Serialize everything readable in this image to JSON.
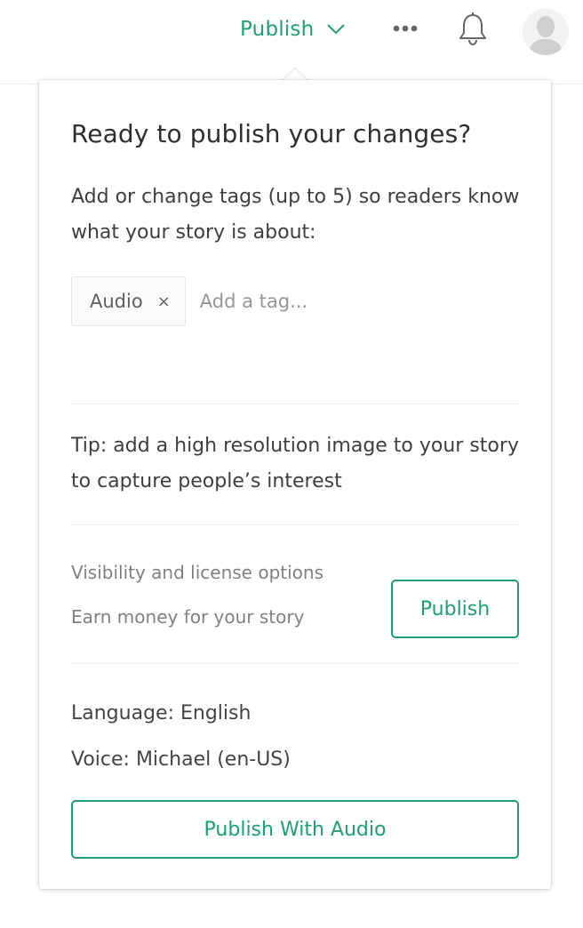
{
  "header": {
    "publish_menu_label": "Publish",
    "accent_color": "#1f9d74"
  },
  "icons": {
    "chevron": "chevron-down-icon",
    "more": "more-horizontal-icon",
    "bell": "bell-icon",
    "avatar": "user-avatar-icon"
  },
  "popover": {
    "title": "Ready to publish your changes?",
    "description": "Add or change tags (up to 5) so readers know what your story is about:",
    "tags": [
      {
        "label": "Audio",
        "remove_symbol": "×"
      }
    ],
    "tag_input_placeholder": "Add a tag...",
    "tip": "Tip: add a high resolution image to your story to capture people’s interest",
    "visibility_link": "Visibility and license options",
    "earn_money_link": "Earn money for your story",
    "publish_button": "Publish",
    "language": "Language: English",
    "voice": "Voice: Michael (en-US)",
    "publish_audio_button": "Publish With Audio"
  }
}
